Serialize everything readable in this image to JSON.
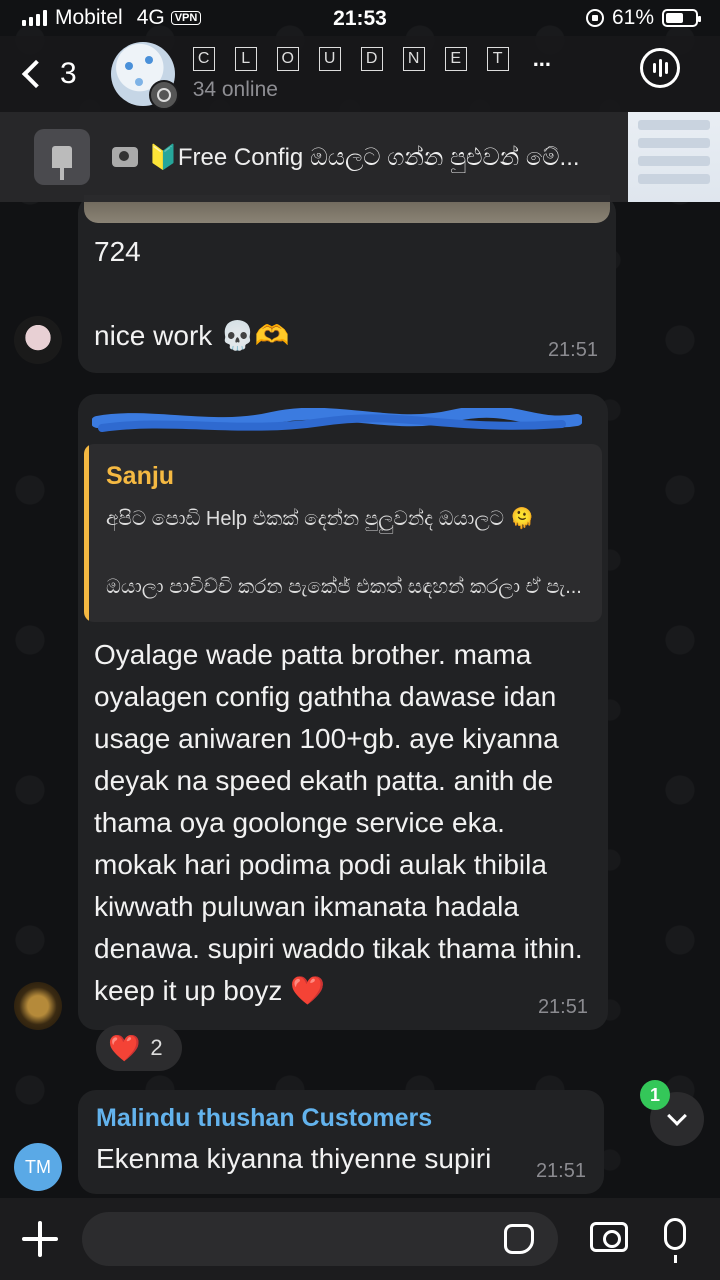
{
  "status_bar": {
    "carrier": "Mobitel",
    "network": "4G",
    "vpn": "VPN",
    "time": "21:53",
    "battery": "61%",
    "battery_level": 0.61
  },
  "header": {
    "back_count": "3",
    "title_letters": [
      "C",
      "L",
      "O",
      "U",
      "D",
      "N",
      "E",
      "T"
    ],
    "title_ellipsis": "...",
    "subtitle": "34 online"
  },
  "pinned": {
    "text": "🔰Free Config ඔයලට ගන්න පුළුවන් මේ..."
  },
  "messages": [
    {
      "lines": [
        "724",
        "",
        "nice work 💀🫶"
      ],
      "time": "21:51"
    },
    {
      "reply": {
        "name": "Sanju",
        "line1": "අපිට පොඩි Help එකක් දෙන්න පුලුවන්ද ඔයාලට 🫠",
        "line2": "ඔයාලා පාවිච්චි කරන පැකේජ් එකත් සඳහන් කරලා ඒ පැ..."
      },
      "text": "Oyalage wade patta brother. mama oyalagen config gaththa dawase idan usage aniwaren 100+gb. aye kiyanna deyak na speed ekath patta. anith de thama oya goolonge service eka. mokak hari podima podi aulak thibila kiwwath puluwan ikmanata hadala denawa. supiri waddo tikak thama ithin. keep it up boyz ❤️",
      "time": "21:51",
      "reaction": {
        "emoji": "❤️",
        "count": "2"
      }
    },
    {
      "sender": "Malindu thushan Customers",
      "text": "Ekenma kiyanna thiyenne supiri",
      "time": "21:51",
      "avatar_initials": "TM"
    }
  ],
  "scroll": {
    "unread": "1"
  },
  "composer": {
    "placeholder": ""
  },
  "colors": {
    "accent_blue": "#63b3ed",
    "reply_yellow": "#f5b942",
    "unread_green": "#34c759",
    "bubble": "#212224"
  }
}
